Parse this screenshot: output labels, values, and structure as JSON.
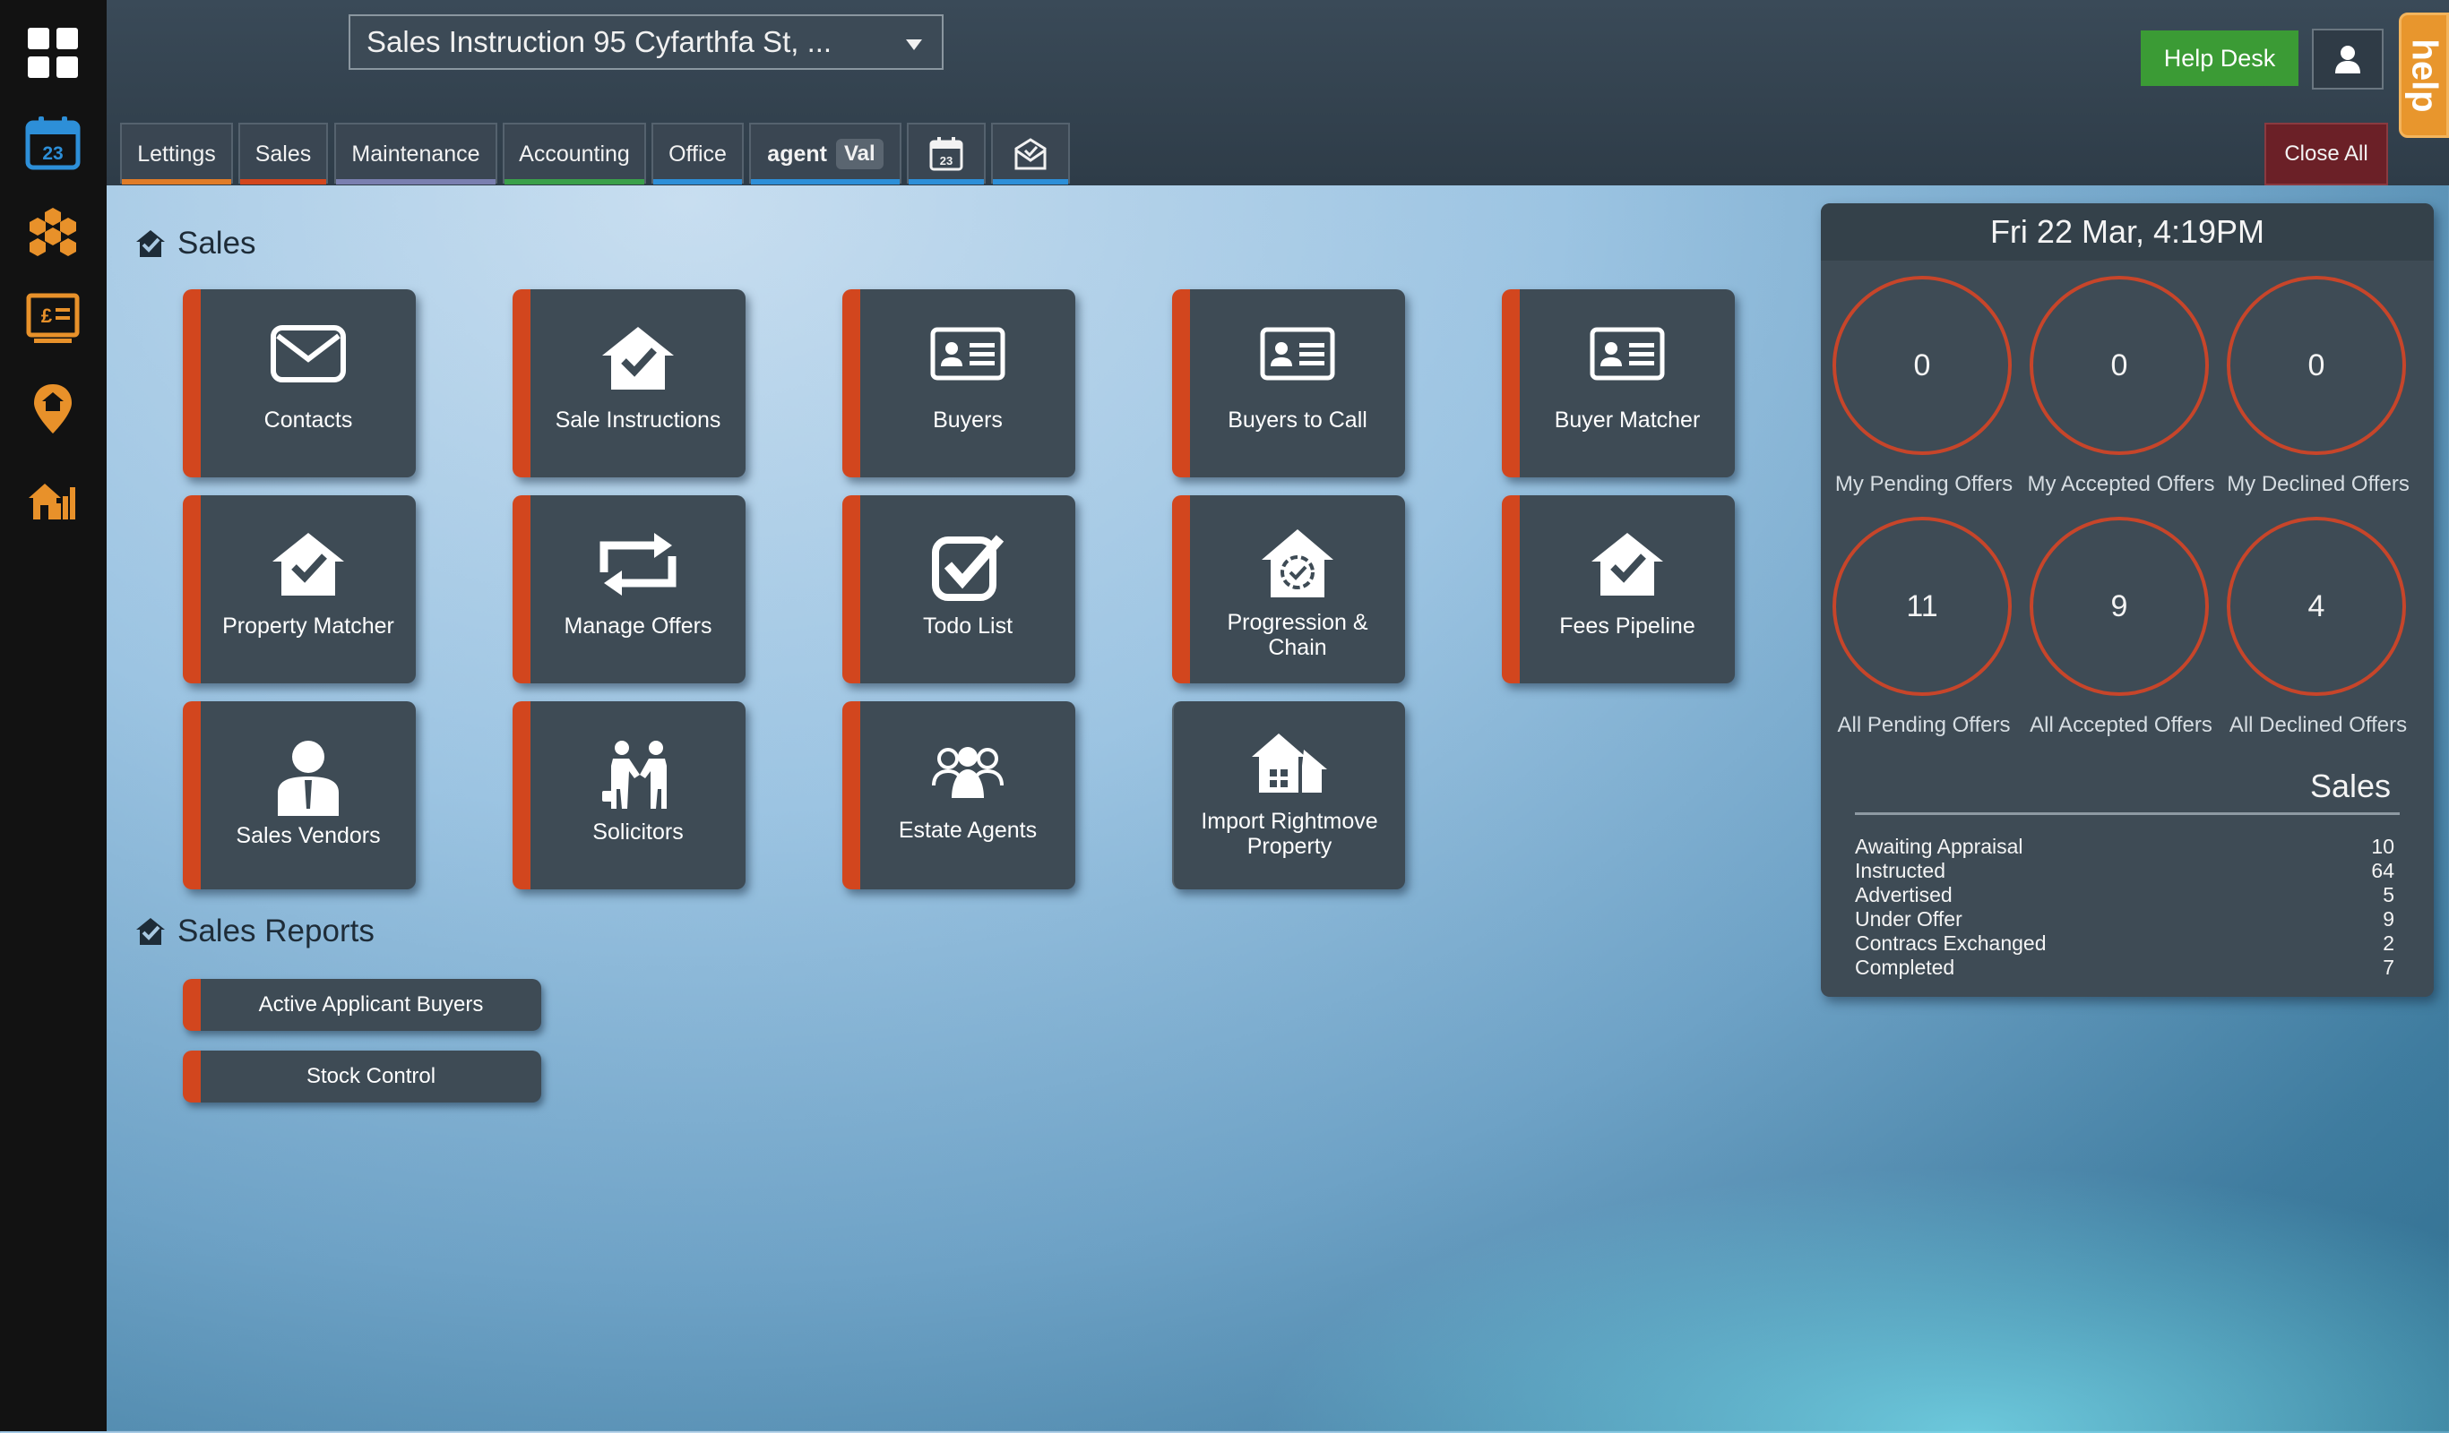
{
  "colors": {
    "accent_orange": "#d2461e",
    "tile_bg": "#3e4b55",
    "help_green": "#3b9b35",
    "close_red": "#6b2027",
    "help_tab": "#e8962d"
  },
  "rail": {
    "icons": [
      "grid-icon",
      "calendar-icon",
      "hexagon-cluster-icon",
      "finance-screen-icon",
      "property-pin-icon",
      "house-chart-icon"
    ],
    "calendar_day": "23"
  },
  "header": {
    "selector_value": "Sales Instruction 95 Cyfarthfa St, ...",
    "tabs": [
      {
        "label": "Lettings"
      },
      {
        "label": "Sales"
      },
      {
        "label": "Maintenance"
      },
      {
        "label": "Accounting"
      },
      {
        "label": "Office"
      },
      {
        "label": "agent",
        "badge": "Val"
      }
    ],
    "calendar_day": "23",
    "help_desk": "Help Desk",
    "help_tab": "help",
    "close_all": "Close All"
  },
  "sales": {
    "title": "Sales",
    "tiles": [
      {
        "label": "Contacts",
        "icon": "envelope-icon"
      },
      {
        "label": "Sale Instructions",
        "icon": "house-check-icon"
      },
      {
        "label": "Buyers",
        "icon": "id-card-icon"
      },
      {
        "label": "Buyers to Call",
        "icon": "id-card-icon"
      },
      {
        "label": "Buyer Matcher",
        "icon": "id-card-icon"
      },
      {
        "label": "Property Matcher",
        "icon": "house-check-icon"
      },
      {
        "label": "Manage Offers",
        "icon": "exchange-arrows-icon"
      },
      {
        "label": "Todo List",
        "icon": "checkbox-icon"
      },
      {
        "label": "Progression & Chain",
        "icon": "house-progress-icon"
      },
      {
        "label": "Fees Pipeline",
        "icon": "house-check-icon"
      },
      {
        "label": "Sales Vendors",
        "icon": "person-icon"
      },
      {
        "label": "Solicitors",
        "icon": "handshake-icon"
      },
      {
        "label": "Estate Agents",
        "icon": "group-icon"
      },
      {
        "label": "Import Rightmove Property",
        "icon": "houses-icon"
      }
    ]
  },
  "reports": {
    "title": "Sales Reports",
    "items": [
      "Active Applicant Buyers",
      "Stock Control"
    ]
  },
  "panel": {
    "datetime": "Fri 22 Mar, 4:19PM",
    "offers": [
      {
        "value": "0",
        "label": "My Pending Offers"
      },
      {
        "value": "0",
        "label": "My Accepted Offers"
      },
      {
        "value": "0",
        "label": "My Declined Offers"
      },
      {
        "value": "11",
        "label": "All Pending Offers"
      },
      {
        "value": "9",
        "label": "All Accepted Offers"
      },
      {
        "value": "4",
        "label": "All Declined Offers"
      }
    ],
    "sales_title": "Sales",
    "stats": [
      {
        "label": "Awaiting Appraisal",
        "value": "10"
      },
      {
        "label": "Instructed",
        "value": "64"
      },
      {
        "label": "Advertised",
        "value": "5"
      },
      {
        "label": "Under Offer",
        "value": "9"
      },
      {
        "label": "Contracs Exchanged",
        "value": "2"
      },
      {
        "label": "Completed",
        "value": "7"
      }
    ]
  }
}
